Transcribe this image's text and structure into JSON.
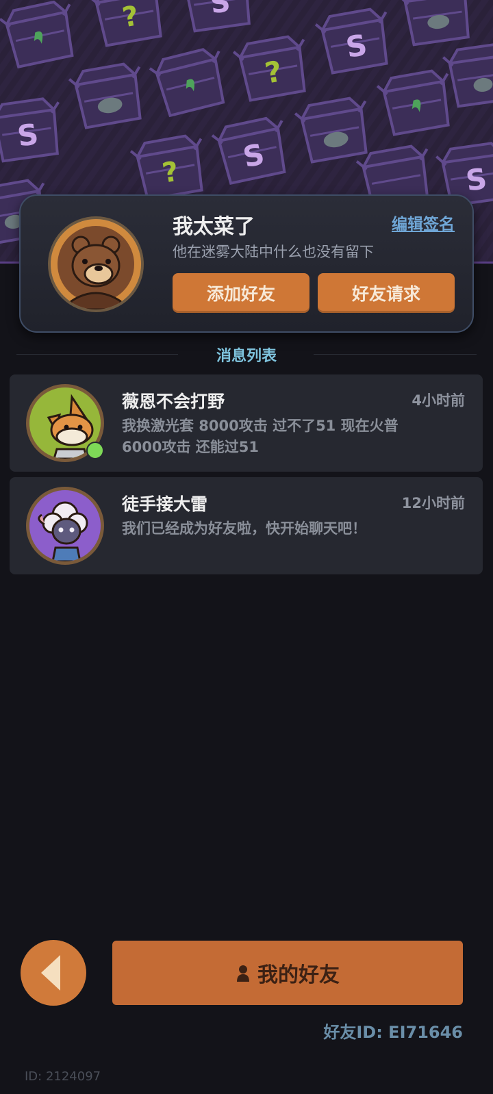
{
  "profile": {
    "name": "我太菜了",
    "edit_sign_label": "编辑签名",
    "signature": "他在迷雾大陆中什么也没有留下",
    "add_friend_label": "添加好友",
    "friend_request_label": "好友请求"
  },
  "section": {
    "title": "消息列表"
  },
  "messages": [
    {
      "name": "薇恩不会打野",
      "time": "4小时前",
      "text": "我换激光套  8000攻击  过不了51  现在火普  6000攻击  还能过51",
      "online": true
    },
    {
      "name": "徒手接大雷",
      "time": "12小时前",
      "text": "我们已经成为好友啦，快开始聊天吧！",
      "online": false
    }
  ],
  "bottom": {
    "my_friends_label": "我的好友",
    "friend_id": "好友ID: EI71646",
    "user_id": "ID: 2124097"
  },
  "colors": {
    "accent_orange": "#cf7736",
    "section_title": "#7fc4de",
    "link_blue": "#6fa6d6",
    "banner_purple": "#2a2139",
    "online_green": "#7ed957"
  }
}
